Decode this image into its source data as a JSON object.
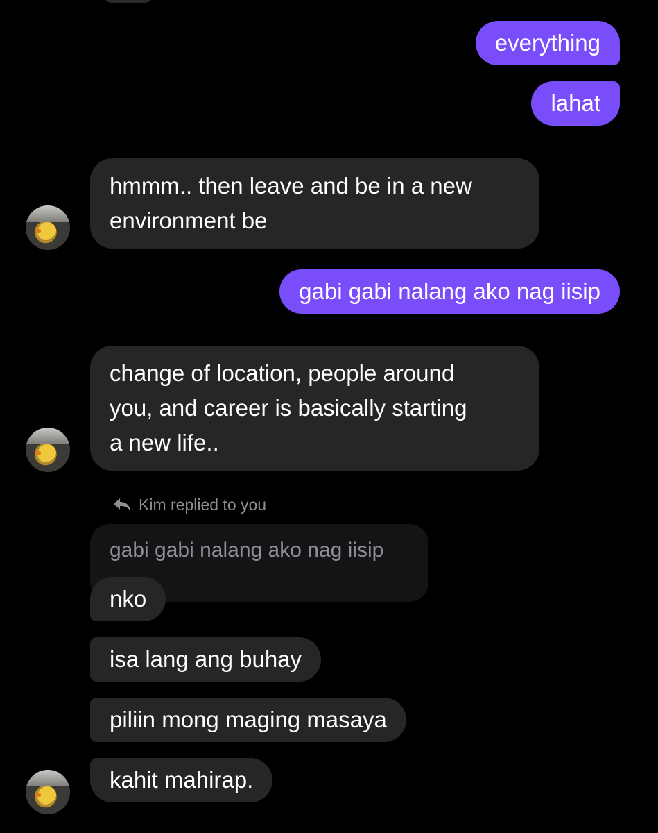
{
  "conversation": {
    "contact_name": "Kim",
    "reply_label": "Kim replied to you",
    "quoted_text": "gabi gabi nalang ako nag iisip",
    "messages": [
      {
        "from": "me",
        "text": "everything"
      },
      {
        "from": "me",
        "text": "lahat"
      },
      {
        "from": "them",
        "lines": [
          "hmmm.. then leave and be in a new",
          "environment be"
        ]
      },
      {
        "from": "me",
        "text": "gabi gabi nalang ako nag iisip"
      },
      {
        "from": "them",
        "lines": [
          "change of location, people around",
          "you, and career is basically starting",
          "a new life.."
        ]
      },
      {
        "from": "them",
        "text": "nko"
      },
      {
        "from": "them",
        "text": "isa lang ang buhay"
      },
      {
        "from": "them",
        "text": "piliin mong maging masaya"
      },
      {
        "from": "them",
        "text": "kahit mahirap."
      }
    ]
  },
  "colors": {
    "background": "#000000",
    "sent_bubble": "#7a4dfb",
    "received_bubble": "#262628",
    "quoted_bubble": "#141416",
    "muted_text": "#8e8e93"
  },
  "icons": {
    "reply": "reply-arrow-icon",
    "avatar": "chick-photo-avatar"
  }
}
